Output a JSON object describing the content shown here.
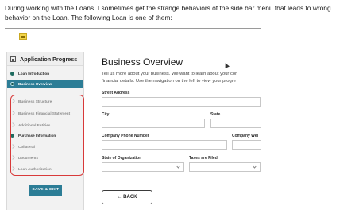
{
  "intro_text": "During working with the Loans, I sometimes get the strange behaviors of the side bar menu that leads to wrong behavior on the Loan. The following Loan is one of them:",
  "sidebar": {
    "title": "Application Progress",
    "items": [
      {
        "label": "Loan Introduction",
        "state": "done"
      },
      {
        "label": "Business Overview",
        "state": "active"
      },
      {
        "label": "Business Structure",
        "state": "todo"
      },
      {
        "label": "Business Financial Statement",
        "state": "todo"
      },
      {
        "label": "Additional Entities",
        "state": "todo"
      },
      {
        "label": "Purchase Information",
        "state": "done"
      },
      {
        "label": "Collateral",
        "state": "todo"
      },
      {
        "label": "Documents",
        "state": "todo"
      },
      {
        "label": "Loan Authorization",
        "state": "todo"
      }
    ],
    "save_label": "SAVE & EXIT"
  },
  "main": {
    "title": "Business Overview",
    "desc_line1": "Tell us more about your business. We want to learn about your cor",
    "desc_line2": "financial details. Use the navigation on the left to view your progre",
    "fields": {
      "street": "Street Address",
      "city": "City",
      "state": "State",
      "phone": "Company Phone Number",
      "website": "Company Wel",
      "state_org": "State of Organization",
      "taxes": "Taxes are Filed"
    },
    "back_label": "← BACK"
  },
  "colors": {
    "accent": "#2c7d96",
    "done_dot": "#1f6b5f",
    "highlight": "#d83a3a"
  }
}
